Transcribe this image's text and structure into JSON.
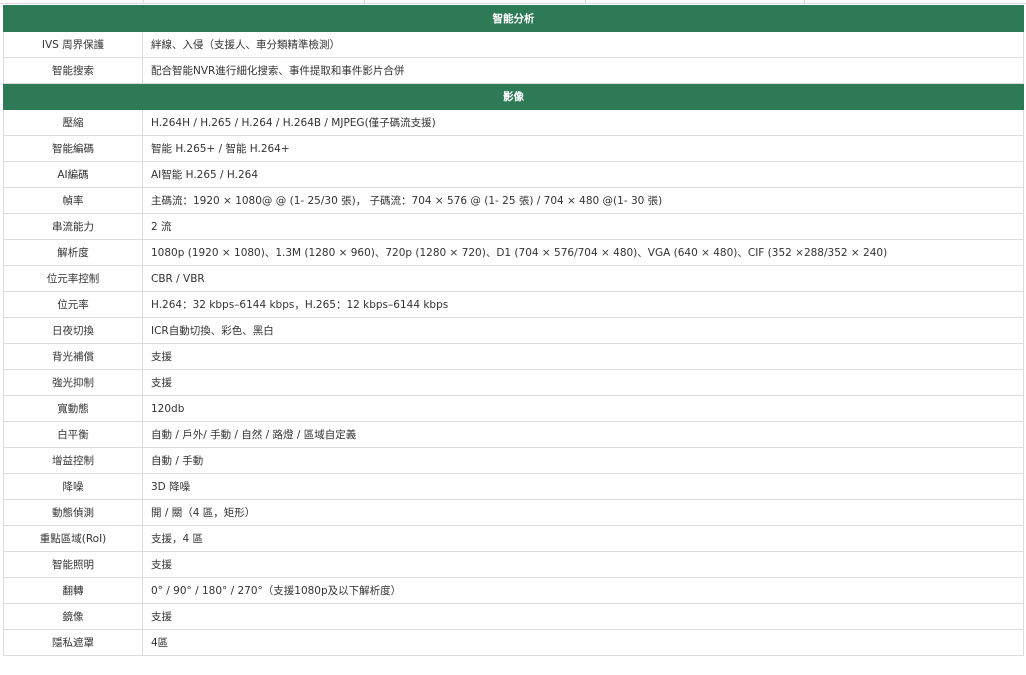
{
  "sections": [
    {
      "title": "智能分析",
      "rows": [
        {
          "label": "IVS 周界保護",
          "value": "絆線、入侵（支援人、車分類精準檢測）"
        },
        {
          "label": "智能搜索",
          "value": "配合智能NVR進行細化搜索、事件提取和事件影片合併"
        }
      ]
    },
    {
      "title": "影像",
      "rows": [
        {
          "label": "壓縮",
          "value": "H.264H / H.265 / H.264 / H.264B / MJPEG(僅子碼流支援)"
        },
        {
          "label": "智能編碼",
          "value": "智能 H.265+ / 智能 H.264+"
        },
        {
          "label": "AI編碼",
          "value": "AI智能 H.265 / H.264"
        },
        {
          "label": "幀率",
          "value": "主碼流：1920 × 1080@ @ (1- 25/30 張)， 子碼流：704 × 576 @ (1- 25 張) / 704 × 480 @(1- 30 張)"
        },
        {
          "label": "串流能力",
          "value": "2 流"
        },
        {
          "label": "解析度",
          "value": "1080p (1920 × 1080)、1.3M (1280 × 960)、720p (1280 × 720)、D1 (704 × 576/704 × 480)、VGA (640 × 480)、CIF (352 ×288/352 × 240)"
        },
        {
          "label": "位元率控制",
          "value": "CBR / VBR"
        },
        {
          "label": "位元率",
          "value": "H.264：32 kbps–6144 kbps，H.265：12 kbps–6144 kbps"
        },
        {
          "label": "日夜切換",
          "value": "ICR自動切換、彩色、黑白"
        },
        {
          "label": "背光補償",
          "value": "支援"
        },
        {
          "label": "強光抑制",
          "value": "支援"
        },
        {
          "label": "寬動態",
          "value": "120db"
        },
        {
          "label": "白平衡",
          "value": "自動 / 戶外/ 手動 / 自然 / 路燈 / 區域自定義"
        },
        {
          "label": "增益控制",
          "value": "自動 / 手動"
        },
        {
          "label": "降噪",
          "value": "3D 降噪"
        },
        {
          "label": "動態偵測",
          "value": "開 / 關（4 區，矩形）"
        },
        {
          "label": "重點區域(RoI)",
          "value": "支援，4 區"
        },
        {
          "label": "智能照明",
          "value": "支援"
        },
        {
          "label": "翻轉",
          "value": "0° / 90° / 180° / 270°（支援1080p及以下解析度）"
        },
        {
          "label": "鏡像",
          "value": "支援"
        },
        {
          "label": "隱私遮罩",
          "value": "4區"
        }
      ]
    }
  ]
}
